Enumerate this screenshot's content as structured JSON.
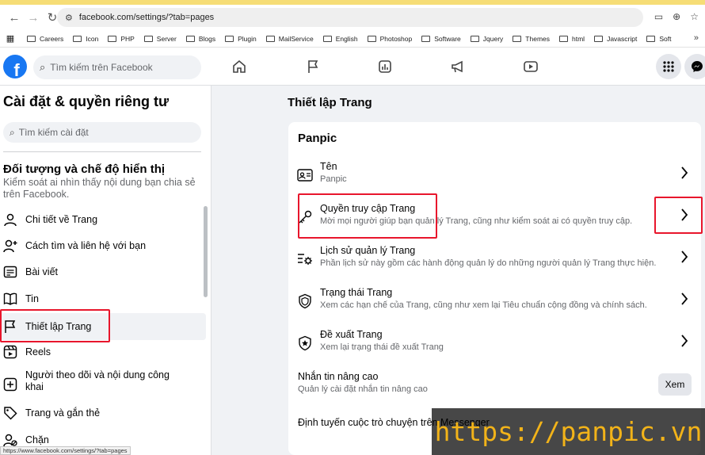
{
  "browser": {
    "url": "facebook.com/settings/?tab=pages",
    "bookmarks": [
      "Careers",
      "Icon",
      "PHP",
      "Server",
      "Blogs",
      "Plugin",
      "MailService",
      "English",
      "Photoshop",
      "Software",
      "Jquery",
      "Themes",
      "html",
      "Javascript",
      "Soft"
    ],
    "status_url": "https://www.facebook.com/settings/?tab=pages"
  },
  "header": {
    "logo": "f",
    "search_placeholder": "Tìm kiếm trên Facebook"
  },
  "sidebar": {
    "title": "Cài đặt & quyền riêng tư",
    "search_placeholder": "Tìm kiếm cài đặt",
    "section_title": "Đối tượng và chế độ hiển thị",
    "section_desc": "Kiểm soát ai nhìn thấy nội dung bạn chia sẻ trên Facebook.",
    "items": [
      {
        "label": "Chi tiết về Trang",
        "icon": "person-icon"
      },
      {
        "label": "Cách tìm và liên hệ với bạn",
        "icon": "person-add-icon"
      },
      {
        "label": "Bài viết",
        "icon": "post-icon"
      },
      {
        "label": "Tin",
        "icon": "book-icon"
      },
      {
        "label": "Thiết lập Trang",
        "icon": "flag-icon"
      },
      {
        "label": "Reels",
        "icon": "reels-icon"
      },
      {
        "label": "Người theo dõi và nội dung công khai",
        "icon": "public-icon"
      },
      {
        "label": "Trang và gắn thẻ",
        "icon": "tag-icon"
      },
      {
        "label": "Chặn",
        "icon": "block-icon"
      }
    ]
  },
  "main": {
    "title": "Thiết lập Trang",
    "card_title": "Panpic",
    "rows": [
      {
        "title": "Tên",
        "sub": "Panpic",
        "icon": "id-card-icon"
      },
      {
        "title": "Quyền truy cập Trang",
        "sub": "Mời mọi người giúp bạn quản lý Trang, cũng như kiểm soát ai có quyền truy cập.",
        "icon": "key-icon"
      },
      {
        "title": "Lịch sử quản lý Trang",
        "sub": "Phần lịch sử này gồm các hành động quản lý do những người quản lý Trang thực hiện.",
        "icon": "history-gear-icon"
      },
      {
        "title": "Trạng thái Trang",
        "sub": "Xem các hạn chế của Trang, cũng như xem lại Tiêu chuẩn cộng đồng và chính sách.",
        "icon": "shield-icon"
      },
      {
        "title": "Đề xuất Trang",
        "sub": "Xem lại trạng thái đề xuất Trang",
        "icon": "star-shield-icon"
      },
      {
        "title": "Nhắn tin nâng cao",
        "sub": "Quản lý cài đặt nhắn tin nâng cao"
      },
      {
        "title": "Định tuyến cuộc trò chuyện trên Messenger",
        "sub": ""
      }
    ],
    "view_button": "Xem"
  },
  "watermark": "https://panpic.vn"
}
